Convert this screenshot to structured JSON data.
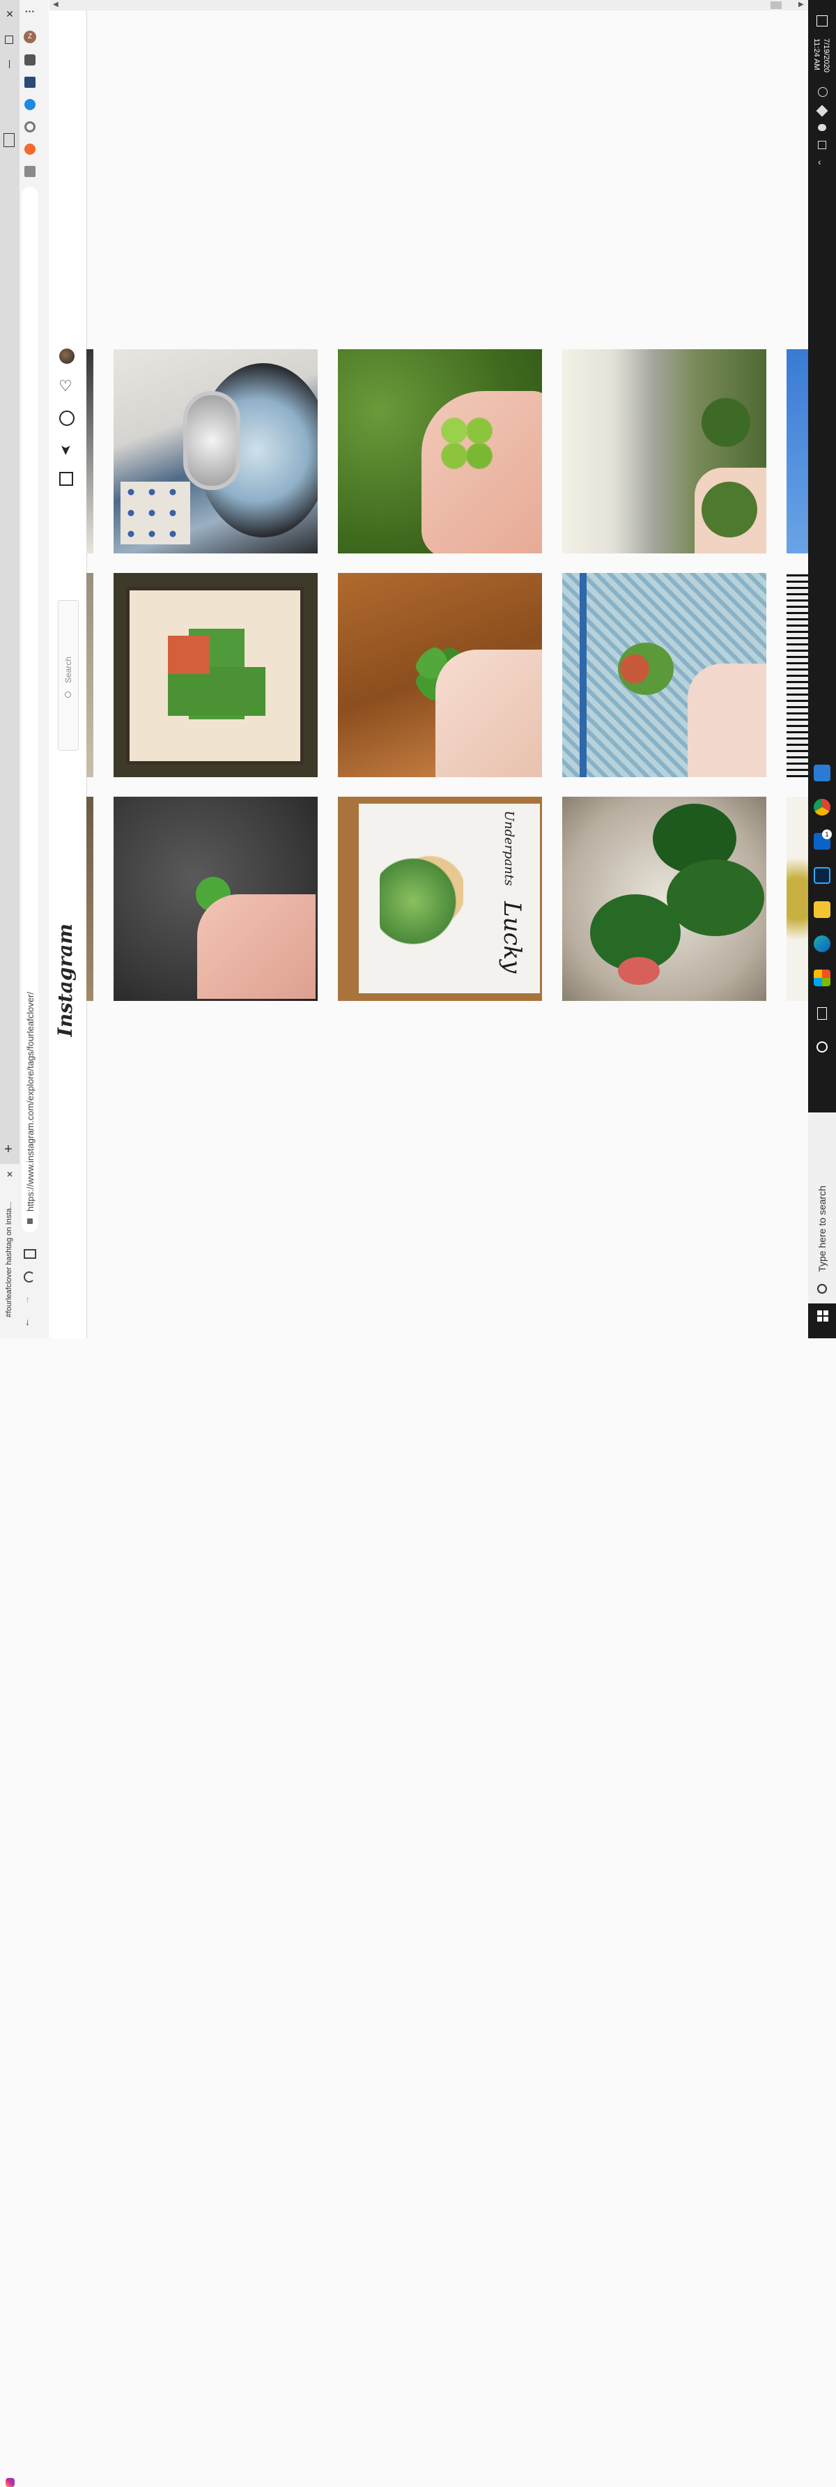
{
  "browser": {
    "tab_title": "#fourleafclover hashtag on Insta...",
    "url": "https://www.instagram.com/explore/tags/fourleafclover/",
    "new_tab_symbol": "+",
    "close_symbol": "✕",
    "more_symbol": "···",
    "profile_initial": "Z"
  },
  "instagram": {
    "logo_text": "Instagram",
    "search_placeholder": "Search"
  },
  "taskbar": {
    "search_placeholder": "Type here to search",
    "time": "11:24 AM",
    "date": "7/19/2020",
    "notification_count": "1"
  },
  "posts": [
    {
      "row": 1,
      "subject": "vintage diamond ring"
    },
    {
      "row": 1,
      "subject": "four-leaf clover held in fingers over grass"
    },
    {
      "row": 1,
      "subject": "two clovers held near a path"
    },
    {
      "row": 2,
      "subject": "wooden clover wall art"
    },
    {
      "row": 2,
      "subject": "four-leaf clover held over wooden table"
    },
    {
      "row": 2,
      "subject": "clover held in front of chain fence"
    },
    {
      "row": 3,
      "subject": "small clover held over dark fabric"
    },
    {
      "row": 3,
      "subject": "Lucky Underpants watercolor card"
    },
    {
      "row": 3,
      "subject": "clover floating in a glass"
    }
  ],
  "card_text": {
    "lucky": "Lucky",
    "underpants": "Underpants"
  },
  "colors": {
    "taskbar": "#1a1a1a",
    "instagram_bg": "#fafafa",
    "clover_green": "#4a9a3a"
  }
}
